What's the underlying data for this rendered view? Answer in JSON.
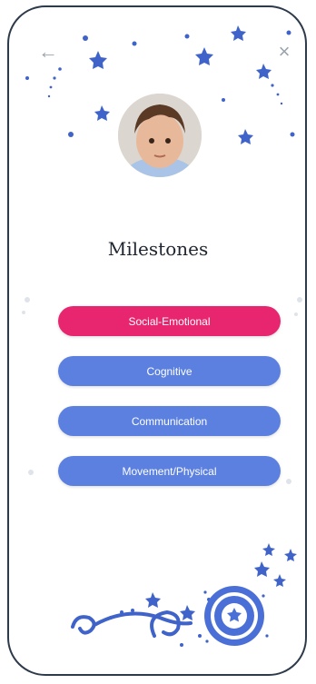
{
  "nav": {
    "back_glyph": "←",
    "close_glyph": "×"
  },
  "avatar": {
    "icon": "baby-photo"
  },
  "title": "Milestones",
  "buttons": [
    {
      "label": "Social-Emotional",
      "active": true
    },
    {
      "label": "Cognitive",
      "active": false
    },
    {
      "label": "Communication",
      "active": false
    },
    {
      "label": "Movement/Physical",
      "active": false
    }
  ],
  "colors": {
    "active": "#e8256f",
    "button": "#5b80e0",
    "stars": "#3f63c8",
    "border": "#2d3a4a"
  }
}
